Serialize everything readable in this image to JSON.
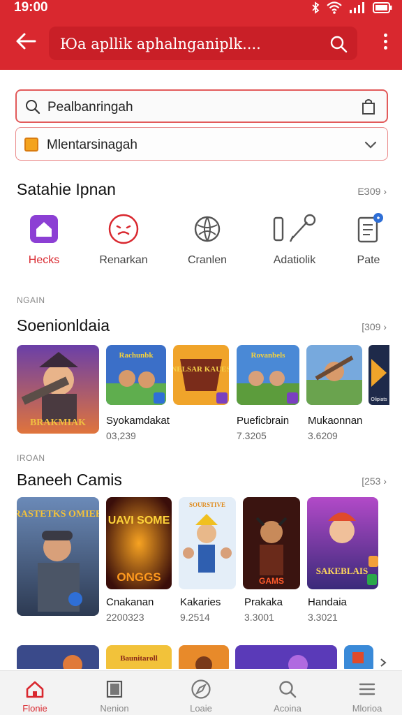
{
  "status": {
    "time": "19:00"
  },
  "toolbar": {
    "url_text": "Юа apllik aphalnganiplk...."
  },
  "search": {
    "value": "Pealbanringah"
  },
  "dropdown": {
    "value": "Mlentarsinagah"
  },
  "section1": {
    "title": "Satahie Ipnan",
    "more": "ЕЗ09 ›",
    "categories": [
      {
        "label": "Hecks"
      },
      {
        "label": "Renarkan"
      },
      {
        "label": "Cranlen"
      },
      {
        "label": "Adatiolik"
      },
      {
        "label": "Pate"
      }
    ]
  },
  "section2": {
    "tag": "NGAIN",
    "title": "Soenionldaia",
    "more": "[309 ›",
    "items": [
      {
        "art": "BRAKMIAK",
        "name": "",
        "sub": ""
      },
      {
        "art": "Rachunbk",
        "name": "Syokamdakat",
        "sub": "03,239"
      },
      {
        "art": "NELSAR KAUES",
        "name": "",
        "sub": ""
      },
      {
        "art": "Rovanbels",
        "name": "Pueficbrain",
        "sub": "7.3205"
      },
      {
        "art": "",
        "name": "Mukaonnan",
        "sub": "3.6209"
      },
      {
        "art": "Olipiats",
        "name": "",
        "sub": ""
      }
    ]
  },
  "section3": {
    "tag": "IROAN",
    "title": "Baneeh Camis",
    "more": "[253 ›",
    "items": [
      {
        "art": "RASTETKS OMIEE",
        "name": "",
        "sub": ""
      },
      {
        "art": "UAVI SOME",
        "art2": "ONGGS",
        "name": "Cnakanan",
        "sub": "2200323"
      },
      {
        "art": "SOURSTIVE",
        "name": "Kakaries",
        "sub": "9.2514"
      },
      {
        "art": "GAMS",
        "name": "Prakaka",
        "sub": "3.3001"
      },
      {
        "art": "SAKEBLAIS",
        "name": "Handaia",
        "sub": "3.3021"
      }
    ]
  },
  "section4": {
    "items": [
      {
        "art": ""
      },
      {
        "art": "Baunitaroll"
      },
      {
        "art": ""
      },
      {
        "art": ""
      },
      {
        "art": ""
      }
    ]
  },
  "nav": [
    {
      "label": "Flonie"
    },
    {
      "label": "Nenion"
    },
    {
      "label": "Loaie"
    },
    {
      "label": "Acoina"
    },
    {
      "label": "Mlorioa"
    }
  ],
  "colors": {
    "accent": "#d9282f"
  }
}
